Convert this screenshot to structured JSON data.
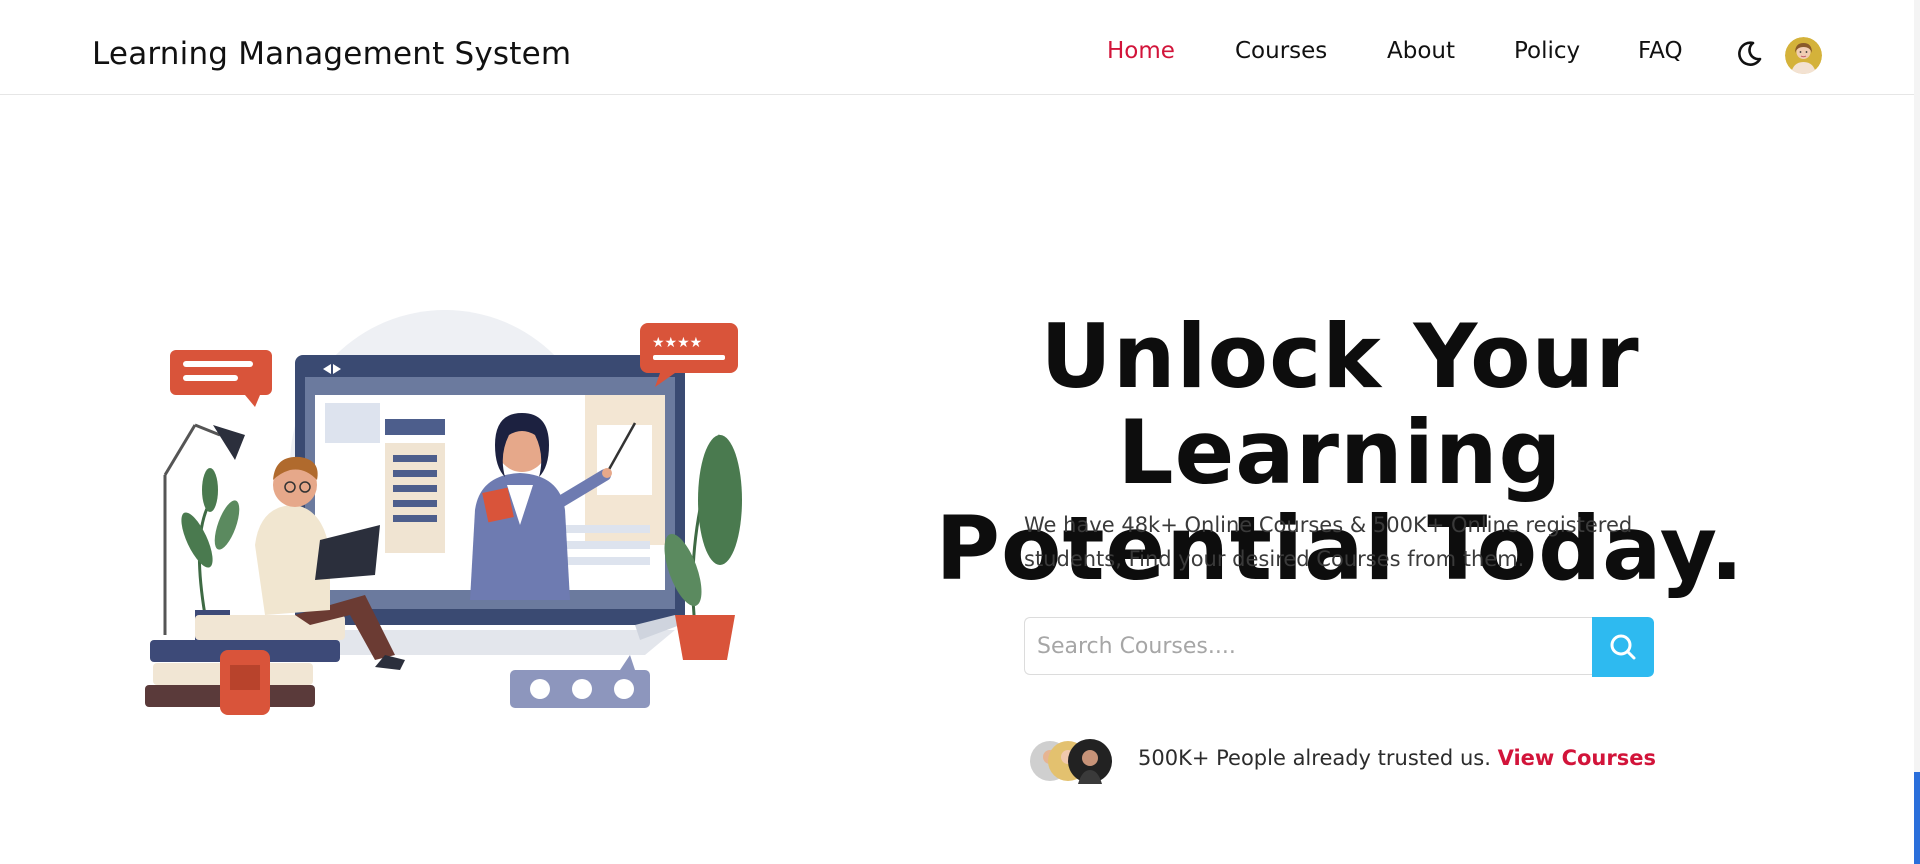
{
  "header": {
    "brand": "Learning Management System",
    "nav": [
      {
        "label": "Home",
        "active": true
      },
      {
        "label": "Courses",
        "active": false
      },
      {
        "label": "About",
        "active": false
      },
      {
        "label": "Policy",
        "active": false
      },
      {
        "label": "FAQ",
        "active": false
      }
    ],
    "theme_toggle_icon": "moon-icon",
    "user_avatar_icon": "avatar"
  },
  "hero": {
    "title_line1": "Unlock Your Learning",
    "title_line2": "Potential Today.",
    "subtitle": "We have 48k+ Online Courses & 500K+ Online registered students, Find your desired Courses from them.",
    "search": {
      "value": "",
      "placeholder": "Search Courses....",
      "button_icon": "search-icon"
    },
    "trust": {
      "text": "500K+ People already trusted us.",
      "link": "View Courses"
    }
  },
  "colors": {
    "accent": "#d2143a",
    "search_button": "#2ebaf0",
    "scrollbar_thumb": "#2a6fdb"
  }
}
